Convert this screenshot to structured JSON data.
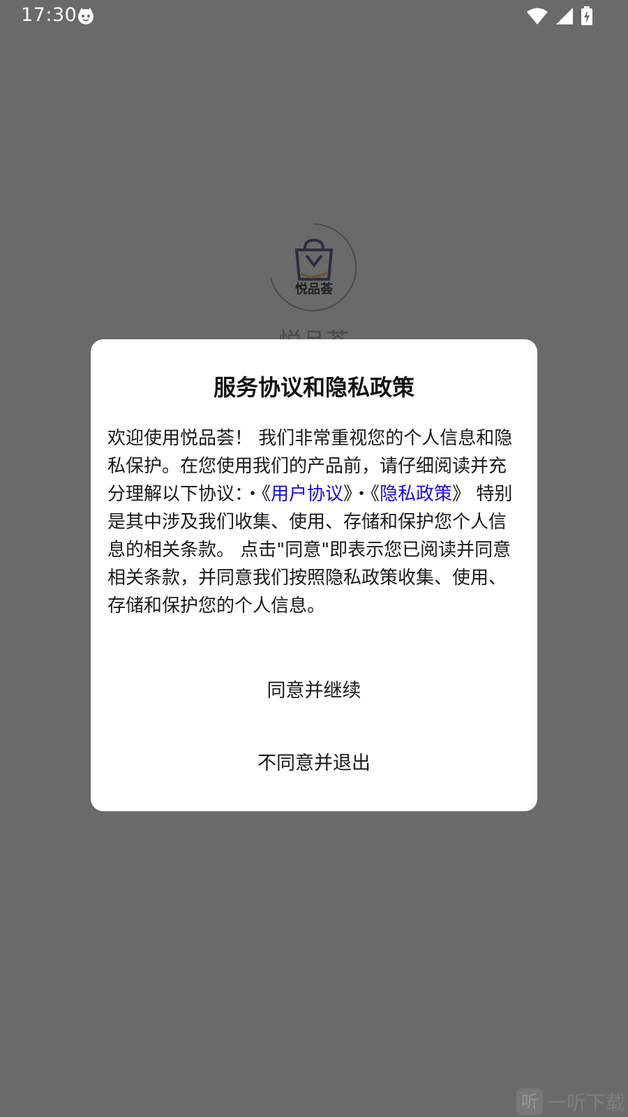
{
  "status_bar": {
    "time": "17:30",
    "icons": [
      "cat-face-icon",
      "wifi-icon",
      "cell-signal-icon",
      "battery-charging-icon"
    ]
  },
  "splash": {
    "app_name": "悦品荟",
    "logo_text": "悦品荟"
  },
  "dialog": {
    "title": "服务协议和隐私政策",
    "body_part1": "欢迎使用悦品荟！ 我们非常重视您的个人信息和隐私保护。在您使用我们的产品前，请仔细阅读并充分理解以下协议：・《",
    "link_user_agreement": "用户协议",
    "body_part2": "》・《",
    "link_privacy_policy": "隐私政策",
    "body_part3": "》 特别是其中涉及我们收集、使用、存储和保护您个人信息的相关条款。 点击\"同意\"即表示您已阅读并同意相关条款，并同意我们按照隐私政策收集、使用、存储和保护您的个人信息。",
    "agree_button": "同意并继续",
    "disagree_button": "不同意并退出"
  },
  "watermark": {
    "icon_char": "听",
    "text": "一听下载"
  },
  "colors": {
    "overlay": "#6a6a6a",
    "link": "#1a0dd8",
    "dialog_bg": "#ffffff"
  }
}
